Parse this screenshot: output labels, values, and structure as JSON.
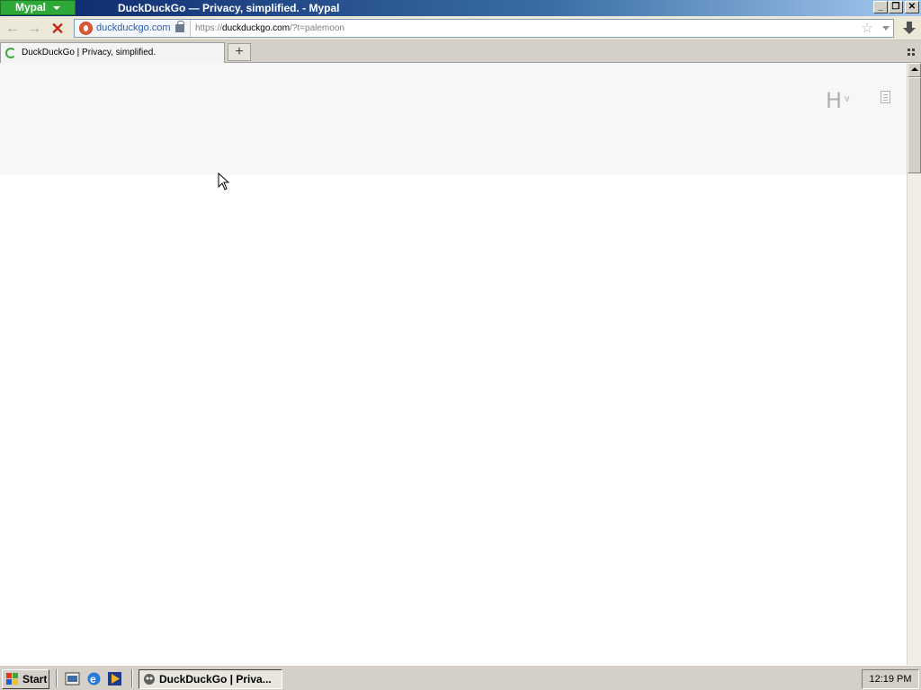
{
  "window": {
    "app_menu_label": "Mypal",
    "title": "DuckDuckGo — Privacy, simplified. - Mypal",
    "controls": {
      "minimize": "_",
      "restore": "❐",
      "close": "✕"
    }
  },
  "nav": {
    "back_icon": "←",
    "forward_icon": "→",
    "stop_icon": "✕",
    "identity_label": "duckduckgo.com",
    "url_prefix": "https://",
    "url_host": "duckduckgo.com",
    "url_suffix": "/?t=palemoon",
    "bookmark_icon": "☆"
  },
  "tabs": {
    "active_title": "DuckDuckGo | Privacy, simplified.",
    "new_tab_icon": "+"
  },
  "page": {
    "logo_letter": "H",
    "logo_chevron": "v"
  },
  "taskbar": {
    "start_label": "Start",
    "task_label": "DuckDuckGo | Priva...",
    "clock": "12:19 PM"
  }
}
